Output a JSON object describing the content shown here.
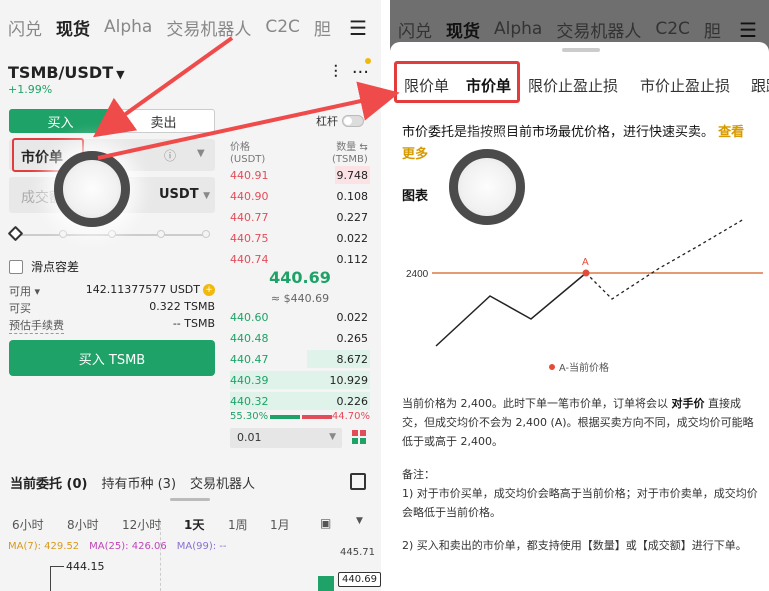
{
  "left": {
    "topnav": [
      "闪兑",
      "现货",
      "Alpha",
      "交易机器人",
      "C2C",
      "胆"
    ],
    "topnav_active": "现货",
    "pair": "TSMB/USDT",
    "change": "+1.99%",
    "tabs": {
      "buy": "买入",
      "sell": "卖出"
    },
    "leverage_label": "杠杆",
    "order_type": "市价单",
    "amount_placeholder": "成交额",
    "amount_currency": "USDT",
    "slippage_label": "滑点容差",
    "available_label": "可用",
    "available_value": "142.11377577 USDT",
    "can_buy_label": "可买",
    "can_buy_value": "0.322 TSMB",
    "fee_label": "预估手续费",
    "fee_value": "-- TSMB",
    "buy_button": "买入 TSMB",
    "orderbook": {
      "price_header": "价格",
      "price_unit": "(USDT)",
      "qty_header": "数量",
      "qty_unit": "(TSMB)",
      "asks": [
        {
          "price": "440.91",
          "qty": "9.748",
          "depth": 0.5
        },
        {
          "price": "440.90",
          "qty": "0.108",
          "depth": 0
        },
        {
          "price": "440.77",
          "qty": "0.227",
          "depth": 0
        },
        {
          "price": "440.75",
          "qty": "0.022",
          "depth": 0
        },
        {
          "price": "440.74",
          "qty": "0.112",
          "depth": 0
        }
      ],
      "last_price": "440.69",
      "last_price_usd": "≈ $440.69",
      "bids": [
        {
          "price": "440.60",
          "qty": "0.022",
          "depth": 0
        },
        {
          "price": "440.48",
          "qty": "0.265",
          "depth": 0
        },
        {
          "price": "440.47",
          "qty": "8.672",
          "depth": 0.45
        },
        {
          "price": "440.39",
          "qty": "10.929",
          "depth": 1.0
        },
        {
          "price": "440.32",
          "qty": "0.226",
          "depth": 1.0
        }
      ],
      "buy_ratio": "55.30%",
      "sell_ratio": "44.70%",
      "precision": "0.01"
    },
    "bottom_tabs": [
      "当前委托 (0)",
      "持有币种 (3)",
      "交易机器人"
    ],
    "timeframes": [
      "6小时",
      "8小时",
      "12小时",
      "1天",
      "1周",
      "1月"
    ],
    "timeframe_active": "1天",
    "ma": [
      {
        "label": "MA(7): 429.52",
        "color": "#d89a1b"
      },
      {
        "label": "MA(25): 426.06",
        "color": "#c045b8"
      },
      {
        "label": "MA(99): --",
        "color": "#8a6fd0"
      }
    ],
    "chart_labels": {
      "high": "444.15",
      "axis_top": "445.71",
      "last": "440.69"
    }
  },
  "right": {
    "topnav": [
      "闪兑",
      "现货",
      "Alpha",
      "交易机器人",
      "C2C",
      "胆"
    ],
    "topnav_active": "现货",
    "sheet_tabs": [
      "限价单",
      "市价单",
      "限价止盈止损",
      "市价止盈止损",
      "跟踪委托"
    ],
    "sheet_tab_active": "市价单",
    "description": "市价委托是指按照目前市场最优价格，进行快速买卖。",
    "learn_more": "查看更多",
    "chart_title": "图表",
    "chart": {
      "level_label": "2400",
      "point_label": "A",
      "legend": "A-当前价格",
      "line_color": "#d97a43",
      "point_color": "#e24d3a"
    },
    "para1_a": "当前价格为 2,400。此时下单一笔市价单，订单将会以",
    "para1_b": "对手价",
    "para1_c": "直接成交，但成交均价不会为 2,400 (A)。根据买卖方向不同，成交均价可能略低于或高于 2,400。",
    "note_title": "备注：",
    "note1": "1) 对于市价买单，成交均价会略高于当前价格；对于市价卖单，成交均价会略低于当前价格。",
    "note2": "2) 买入和卖出的市价单，都支持使用【数量】或【成交额】进行下单。"
  },
  "colors": {
    "green": "#1ea267",
    "red": "#e24d5a",
    "highlight": "#e23c3c",
    "accent": "#d79a00"
  }
}
